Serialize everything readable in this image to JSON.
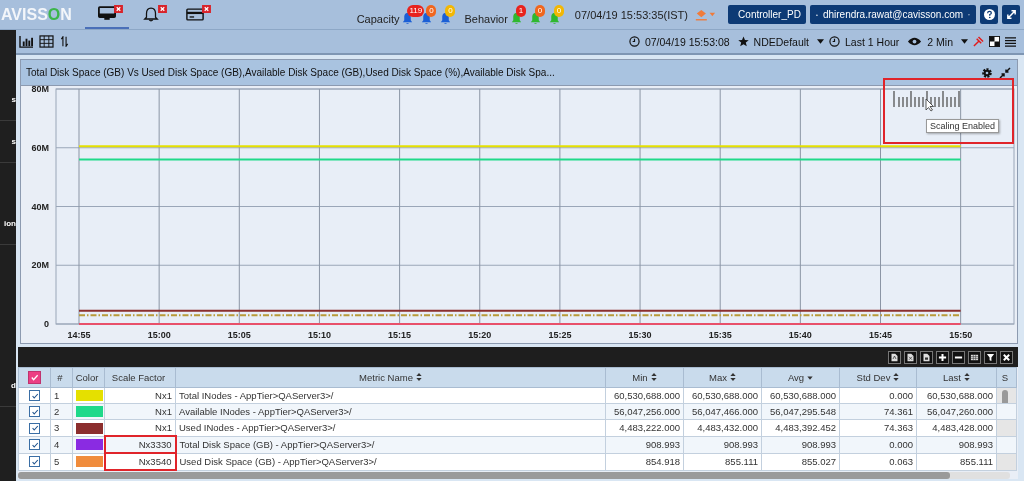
{
  "topbar": {
    "logo": {
      "before": "AVISS",
      "accent": "O",
      "after": "N"
    },
    "tabs": [
      {
        "kind": "monitor",
        "selected": true
      },
      {
        "kind": "bell",
        "selected": false
      },
      {
        "kind": "card",
        "selected": false
      }
    ],
    "capacity": {
      "label": "Capacity",
      "alerts": [
        {
          "count": "119",
          "color": "#e8231e"
        },
        {
          "count": "0",
          "color": "#f0661e"
        },
        {
          "count": "0",
          "color": "#f2b705"
        }
      ]
    },
    "behavior": {
      "label": "Behavior",
      "alerts": [
        {
          "count": "1",
          "color": "#e8231e"
        },
        {
          "count": "0",
          "color": "#f0661e"
        },
        {
          "count": "0",
          "color": "#f2b705"
        }
      ]
    },
    "datetime": "07/04/19 15:53:35(IST)",
    "controller": "Controller_PD",
    "user": "dhirendra.rawat@cavisson.com"
  },
  "toolbar": {
    "time": "07/04/19 15:53:08",
    "favorite": "NDEDefault",
    "range": "Last 1 Hour",
    "refresh": "2 Min"
  },
  "sidebar": {
    "items": [
      "s",
      "s",
      "ion",
      "d"
    ]
  },
  "chart_panel": {
    "title": "Total Disk Space (GB) Vs Used Disk Space (GB),Available Disk Space (GB),Used Disk Space (%),Available Disk Spa...",
    "scaling": {
      "tooltip": "Scaling Enabled",
      "highlighted": true
    },
    "chart_data": {
      "type": "line",
      "grid": true,
      "categories": [
        "14:55",
        "15:00",
        "15:05",
        "15:10",
        "15:15",
        "15:20",
        "15:25",
        "15:30",
        "15:35",
        "15:40",
        "15:45",
        "15:50"
      ],
      "ylim": [
        0,
        80000000
      ],
      "yticks": [
        {
          "value": 0,
          "label": "0"
        },
        {
          "value": 20000000,
          "label": "20M"
        },
        {
          "value": 40000000,
          "label": "40M"
        },
        {
          "value": 60000000,
          "label": "60M"
        },
        {
          "value": 80000000,
          "label": "80M"
        }
      ],
      "series": [
        {
          "color": "#e5e000",
          "line_style": "solid",
          "values": [
            60500000,
            60500000,
            60500000,
            60500000,
            60500000,
            60500000,
            60500000,
            60500000,
            60500000,
            60500000,
            60500000,
            60500000
          ]
        },
        {
          "color": "#1fd98a",
          "line_style": "solid",
          "values": [
            56000000,
            56000000,
            56000000,
            56000000,
            56000000,
            56000000,
            56000000,
            56000000,
            56000000,
            56000000,
            56000000,
            56000000
          ]
        },
        {
          "color": "#8b2e2e",
          "line_style": "solid",
          "values": [
            4500000,
            4500000,
            4500000,
            4500000,
            4500000,
            4500000,
            4500000,
            4500000,
            4500000,
            4500000,
            4500000,
            4500000
          ]
        },
        {
          "color": "#b89a3a",
          "line_style": "dashdot",
          "values": [
            3000000,
            3000000,
            3000000,
            3000000,
            3000000,
            3000000,
            3000000,
            3000000,
            3000000,
            3000000,
            3000000,
            3000000
          ]
        },
        {
          "color": "#e8506a",
          "line_style": "solid",
          "values": [
            0,
            0,
            0,
            0,
            0,
            0,
            0,
            0,
            0,
            0,
            0,
            0
          ]
        }
      ]
    }
  },
  "table": {
    "all_checked": true,
    "columns": [
      {
        "label": "#",
        "kind": "plain"
      },
      {
        "label": "Color",
        "kind": "plain"
      },
      {
        "label": "Scale Factor",
        "kind": "plain"
      },
      {
        "label": "Metric Name",
        "kind": "sortable"
      },
      {
        "label": "Min",
        "kind": "sortable"
      },
      {
        "label": "Max",
        "kind": "sortable"
      },
      {
        "label": "Avg",
        "kind": "sorted"
      },
      {
        "label": "Std Dev",
        "kind": "sortable"
      },
      {
        "label": "Last",
        "kind": "sortable"
      },
      {
        "label": "S",
        "kind": "plain"
      }
    ],
    "rows": [
      {
        "checked": true,
        "number": "1",
        "color": "#e5e000",
        "scale": "Nx1",
        "highlighted": false,
        "metric": "Total INodes - AppTier>QAServer3>/",
        "min": "60,530,688.000",
        "max": "60,530,688.000",
        "avg": "60,530,688.000",
        "std_dev": "0.000",
        "last": "60,530,688.000"
      },
      {
        "checked": true,
        "number": "2",
        "color": "#1fd98a",
        "scale": "Nx1",
        "highlighted": false,
        "metric": "Available INodes - AppTier>QAServer3>/",
        "min": "56,047,256.000",
        "max": "56,047,466.000",
        "avg": "56,047,295.548",
        "std_dev": "74.361",
        "last": "56,047,260.000"
      },
      {
        "checked": true,
        "number": "3",
        "color": "#8b2e2e",
        "scale": "Nx1",
        "highlighted": false,
        "metric": "Used INodes - AppTier>QAServer3>/",
        "min": "4,483,222.000",
        "max": "4,483,432.000",
        "avg": "4,483,392.452",
        "std_dev": "74.363",
        "last": "4,483,428.000"
      },
      {
        "checked": true,
        "number": "4",
        "color": "#8a2be2",
        "scale": "Nx3330",
        "highlighted": true,
        "metric": "Total Disk Space (GB) - AppTier>QAServer3>/",
        "min": "908.993",
        "max": "908.993",
        "avg": "908.993",
        "std_dev": "0.000",
        "last": "908.993"
      },
      {
        "checked": true,
        "number": "5",
        "color": "#f08c3c",
        "scale": "Nx3540",
        "highlighted": true,
        "metric": "Used Disk Space (GB) - AppTier>QAServer3>/",
        "min": "854.918",
        "max": "855.111",
        "avg": "855.027",
        "std_dev": "0.063",
        "last": "855.111"
      }
    ]
  }
}
